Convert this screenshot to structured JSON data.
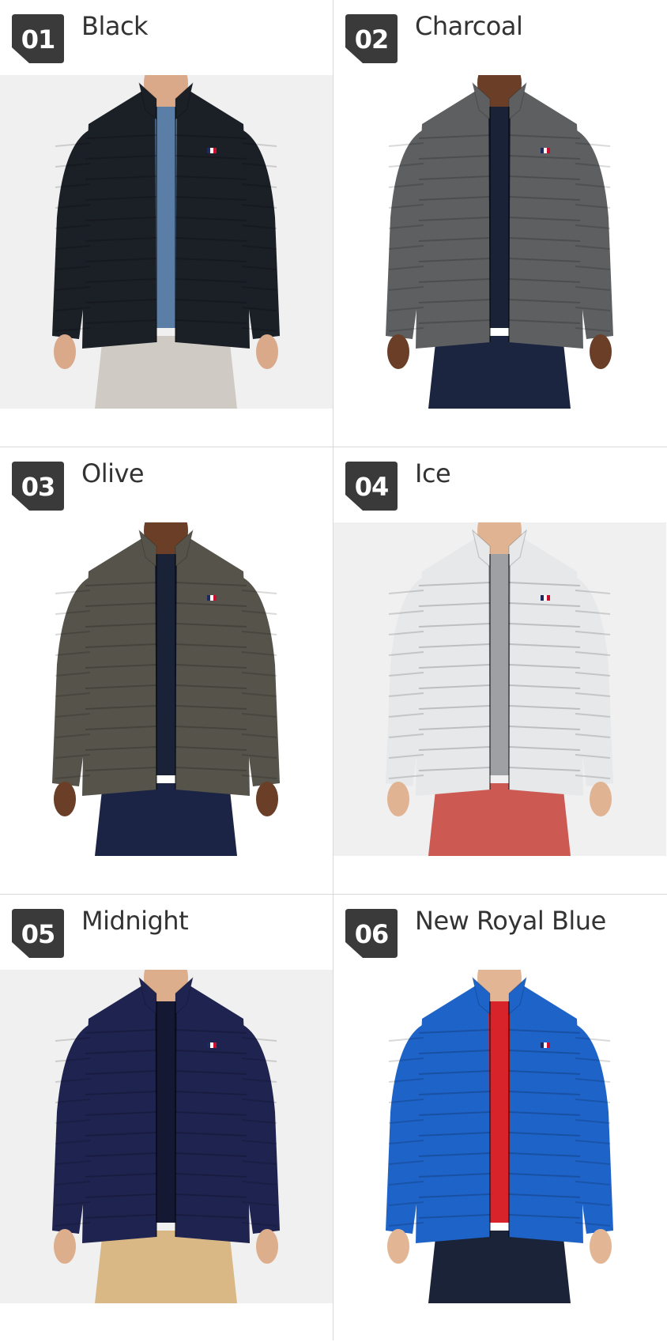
{
  "products": [
    {
      "num": "01",
      "name": "Black",
      "jacket_color": "#1b1f26",
      "shirt_color": "#5a7ea6",
      "pants_color": "#cfcac3",
      "skin": "#d9a98a",
      "bg": "#f0f0f0"
    },
    {
      "num": "02",
      "name": "Charcoal",
      "jacket_color": "#5d5f61",
      "shirt_color": "#1a2238",
      "pants_color": "#1c2540",
      "skin": "#6b3f27",
      "bg": "#ffffff"
    },
    {
      "num": "03",
      "name": "Olive",
      "jacket_color": "#55534a",
      "shirt_color": "#1a2238",
      "pants_color": "#1b2444",
      "skin": "#6b3f27",
      "bg": "#ffffff"
    },
    {
      "num": "04",
      "name": "Ice",
      "jacket_color": "#e6e8ea",
      "shirt_color": "#9ea0a3",
      "pants_color": "#cc5a52",
      "skin": "#e0b492",
      "bg": "#f0f0f0"
    },
    {
      "num": "05",
      "name": "Midnight",
      "jacket_color": "#1f2350",
      "shirt_color": "#141833",
      "pants_color": "#d9b885",
      "skin": "#dcae8c",
      "bg": "#f0f0f0"
    },
    {
      "num": "06",
      "name": "New Royal Blue",
      "jacket_color": "#1e63c8",
      "shirt_color": "#d8232a",
      "pants_color": "#1b2338",
      "skin": "#e2b694",
      "bg": "#ffffff"
    }
  ]
}
